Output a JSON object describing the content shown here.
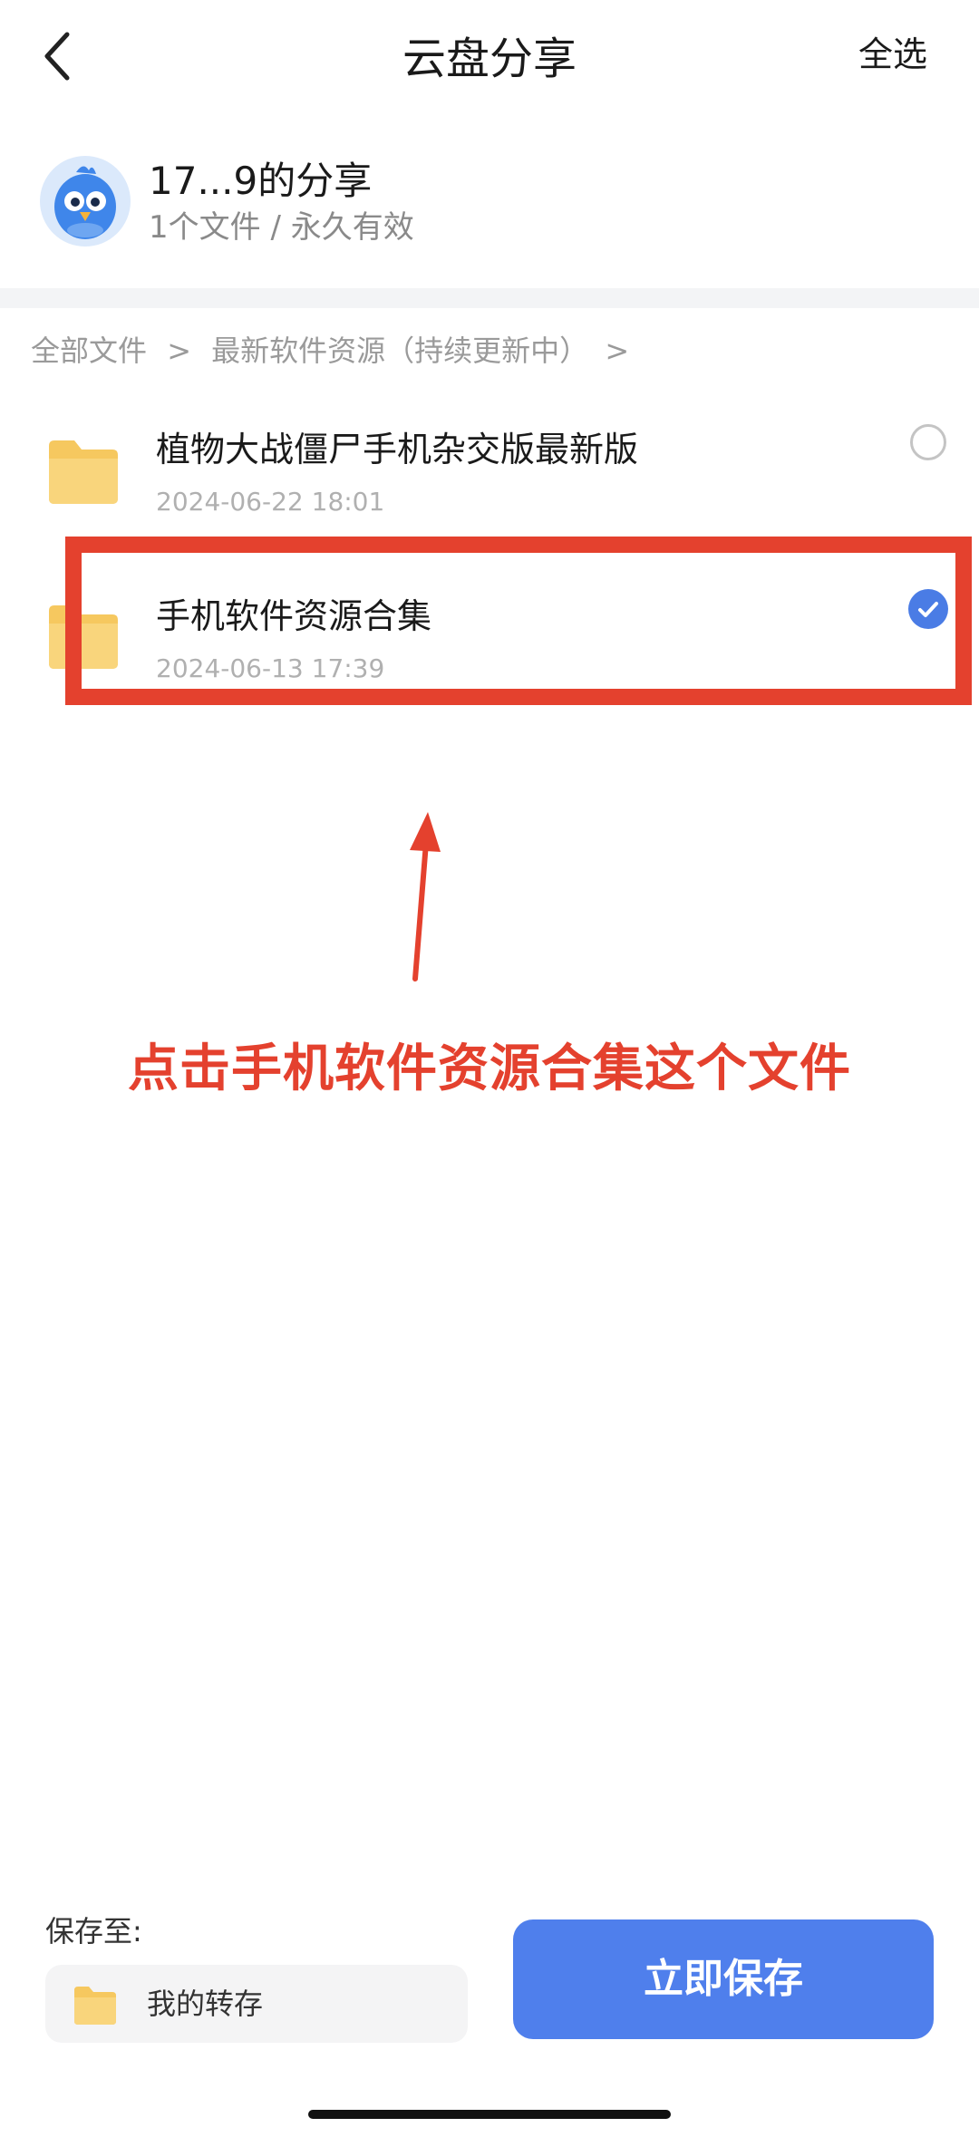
{
  "header": {
    "title": "云盘分享",
    "select_all_label": "全选",
    "back_icon": "chevron-left-icon"
  },
  "share": {
    "name": "17...9的分享",
    "meta": "1个文件 / 永久有效",
    "avatar_icon": "bird-avatar-icon"
  },
  "breadcrumb": {
    "items": [
      "全部文件",
      ">",
      "最新软件资源（持续更新中）",
      ">"
    ]
  },
  "files": [
    {
      "name": "植物大战僵尸手机杂交版最新版",
      "date": "2024-06-22 18:01",
      "selected": false,
      "icon": "folder-icon"
    },
    {
      "name": "手机软件资源合集",
      "date": "2024-06-13 17:39",
      "selected": true,
      "icon": "folder-icon"
    }
  ],
  "annotation": {
    "text": "点击手机软件资源合集这个文件",
    "color": "#e4412e"
  },
  "bottom": {
    "save_to_label": "保存至:",
    "save_to_value": "我的转存",
    "save_button_label": "立即保存"
  },
  "colors": {
    "accent": "#4f7fec",
    "folder": "#f8cd6a",
    "annotation": "#e4412e"
  }
}
